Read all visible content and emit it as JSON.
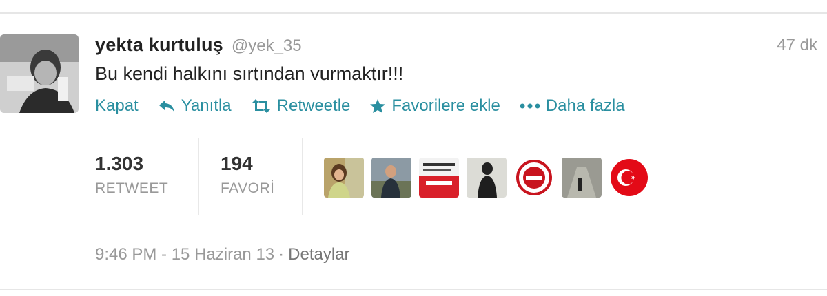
{
  "tweet": {
    "fullname": "yekta kurtuluş",
    "screen_name": "@yek_35",
    "time": "47 dk",
    "text": "Bu kendi halkını sırtından vurmaktır!!!"
  },
  "actions": {
    "close": "Kapat",
    "reply": "Yanıtla",
    "retweet": "Retweetle",
    "favorite": "Favorilere ekle",
    "more": "Daha fazla"
  },
  "stats": {
    "retweet_count": "1.303",
    "retweet_label": "RETWEET",
    "favorite_count": "194",
    "favorite_label": "FAVORİ"
  },
  "footer": {
    "timestamp": "9:46 PM - 15 Haziran 13",
    "separator": "·",
    "details": "Detaylar"
  },
  "colors": {
    "link": "#2a8fa0",
    "muted": "#999999",
    "text": "#222222",
    "flag_red": "#e30a17"
  }
}
